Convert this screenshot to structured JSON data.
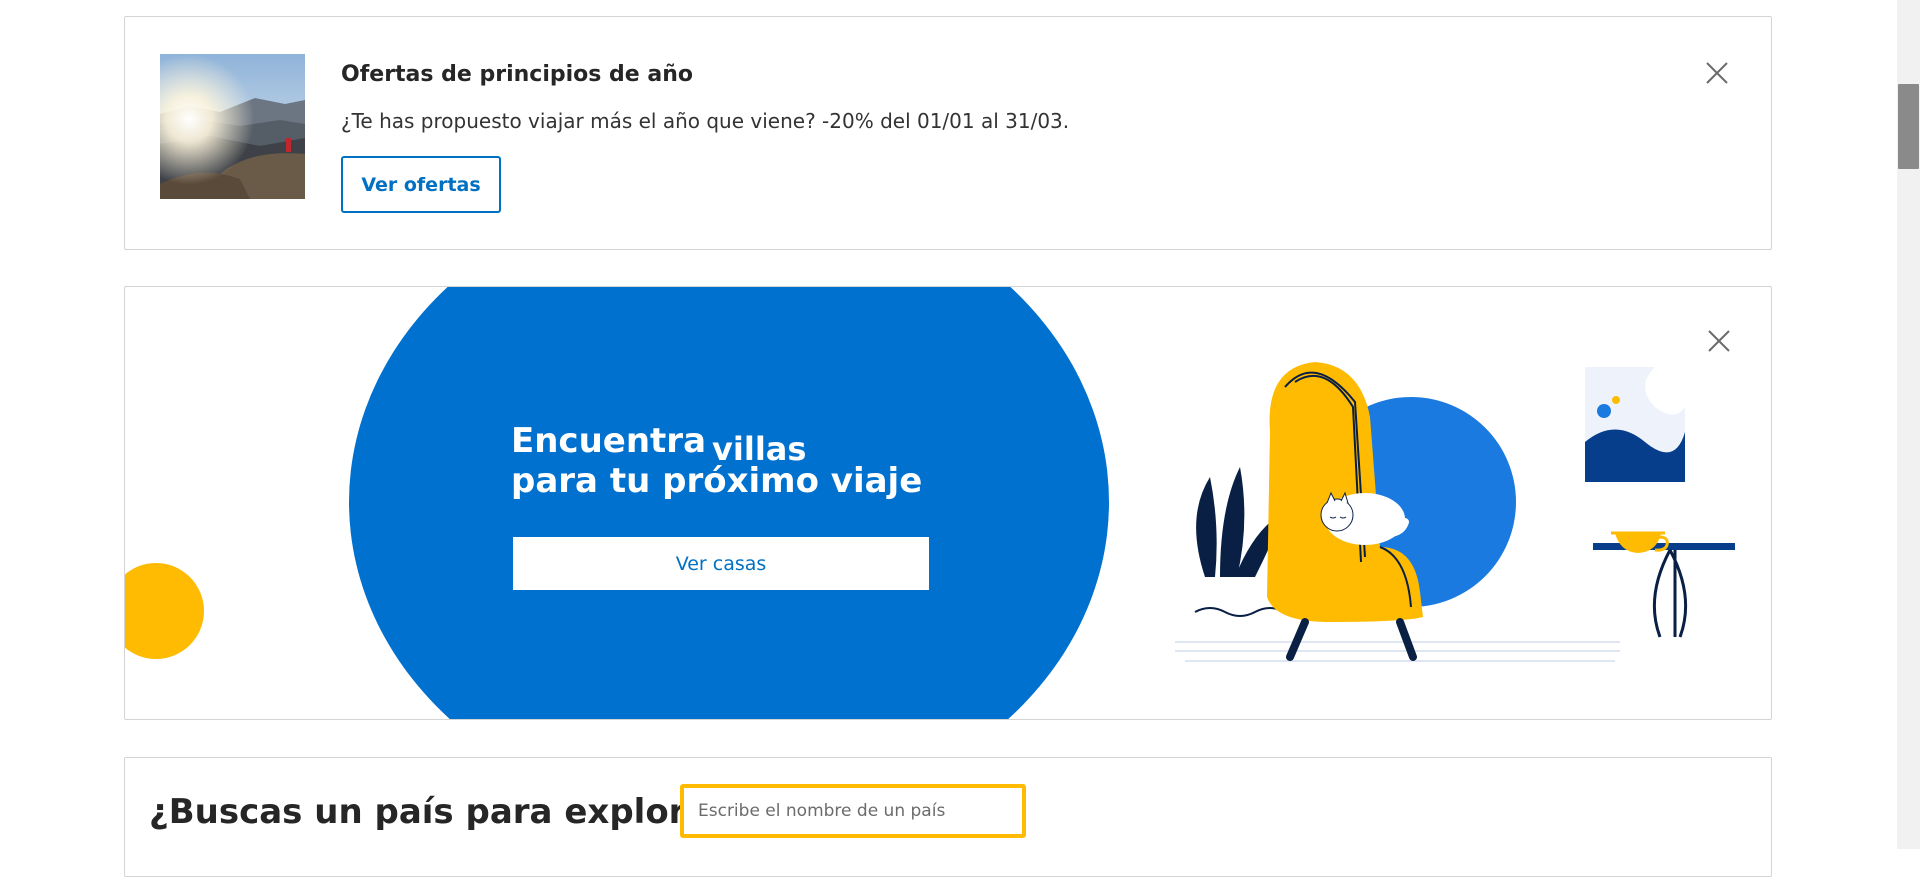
{
  "promo": {
    "image_alt": "mountain-landscape-thumbnail",
    "title": "Ofertas de principios de año",
    "text": "¿Te has propuesto viajar más el año que viene? -20% del 01/01 al 31/03.",
    "button_label": "Ver ofertas",
    "close_icon": "close-icon"
  },
  "villa_banner": {
    "headline_part1": "Encuentra",
    "headline_accent": "villas",
    "headline_part2": "para tu próximo viaje",
    "button_label": "Ver casas",
    "close_icon": "close-icon",
    "illustration": "armchair-cat-illustration"
  },
  "country_search": {
    "question": "¿Buscas un país para explorar?",
    "placeholder": "Escribe el nombre de un país"
  },
  "colors": {
    "brand_blue": "#0071c2",
    "accent_yellow": "#febb02",
    "dark_navy": "#0a1f44",
    "border_gray": "#d4d4d4"
  }
}
